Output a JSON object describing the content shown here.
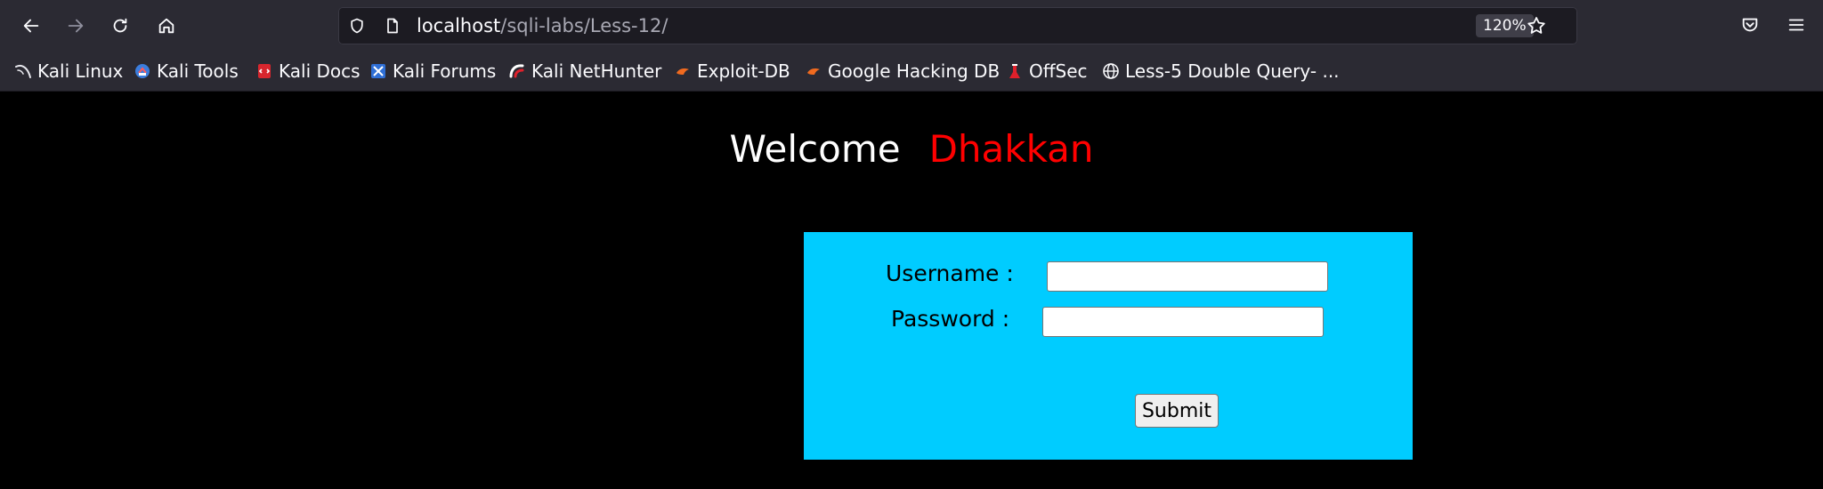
{
  "browser": {
    "url": {
      "host": "localhost",
      "path": "/sqli-labs/Less-12/"
    },
    "zoom": "120%",
    "bookmarks": [
      {
        "label": "Kali Linux",
        "icon": "kali-dragon-icon"
      },
      {
        "label": "Kali Tools",
        "icon": "kali-tools-icon"
      },
      {
        "label": "Kali Docs",
        "icon": "kali-docs-icon"
      },
      {
        "label": "Kali Forums",
        "icon": "kali-forums-icon"
      },
      {
        "label": "Kali NetHunter",
        "icon": "kali-nethunter-icon"
      },
      {
        "label": "Exploit-DB",
        "icon": "exploit-db-icon"
      },
      {
        "label": "Google Hacking DB",
        "icon": "ghdb-icon"
      },
      {
        "label": "OffSec",
        "icon": "offsec-icon"
      },
      {
        "label": "Less-5 Double Query- ...",
        "icon": "globe-icon"
      }
    ]
  },
  "page": {
    "welcome_word": "Welcome",
    "welcome_name": "Dhakkan",
    "form": {
      "username_label": "Username :",
      "password_label": "Password :",
      "username_value": "",
      "password_value": "",
      "submit_label": "Submit"
    }
  },
  "colors": {
    "page_bg": "#000000",
    "form_bg": "#00ccff",
    "name_color": "#ff0000",
    "chrome_bg": "#2b2a33"
  }
}
